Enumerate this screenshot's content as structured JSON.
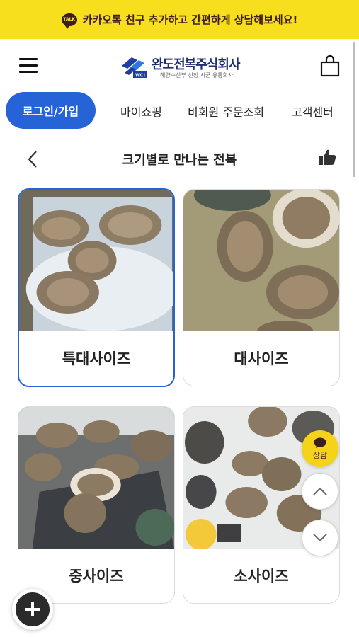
{
  "banner": {
    "text": "카카오톡 친구 추가하고 간편하게 상담해보세요!",
    "badge": "TALK"
  },
  "header": {
    "logo_title": "완도전복주식회사",
    "logo_mark_text": "WCI",
    "logo_subtitle": "해양수산부 선정 시군 유통회사"
  },
  "nav": {
    "login_label": "로그인/가입",
    "items": [
      "마이쇼핑",
      "비회원 주문조회",
      "고객센터"
    ]
  },
  "subheader": {
    "title": "크기별로 만나는 전복"
  },
  "products": [
    {
      "label": "특대사이즈",
      "selected": true
    },
    {
      "label": "대사이즈",
      "selected": false
    },
    {
      "label": "중사이즈",
      "selected": false
    },
    {
      "label": "소사이즈",
      "selected": false
    }
  ],
  "floating": {
    "chat_label": "상담"
  },
  "colors": {
    "banner": "#f7df1e",
    "accent": "#2563d6",
    "chat": "#f5d31a"
  }
}
